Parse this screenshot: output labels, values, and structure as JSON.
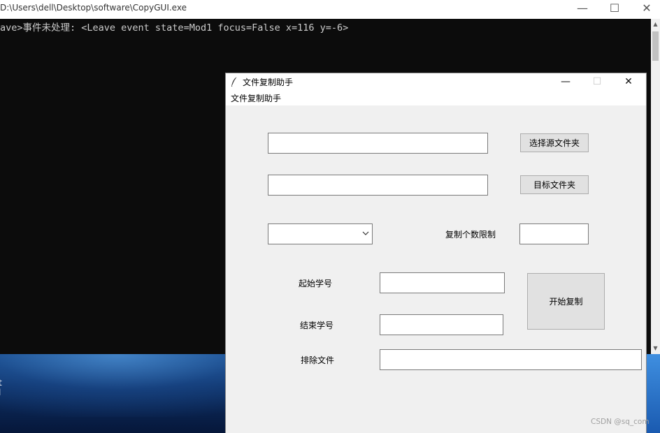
{
  "console": {
    "title": "D:\\Users\\dell\\Desktop\\software\\CopyGUI.exe",
    "output_line": "ave>事件未处理: <Leave event state=Mod1 focus=False x=116 y=-6>",
    "controls": {
      "minimize": "—",
      "maximize": "☐",
      "close": "✕"
    }
  },
  "desktop": {
    "fragment_text": "t\nl"
  },
  "app": {
    "title": "文件复制助手",
    "menu_label": "文件复制助手",
    "controls": {
      "minimize": "—",
      "maximize": "☐",
      "close": "✕"
    },
    "source_path": {
      "value": ""
    },
    "target_path": {
      "value": ""
    },
    "select_source_button": "选择源文件夹",
    "target_folder_button": "目标文件夹",
    "combo": {
      "value": ""
    },
    "copy_limit": {
      "label": "复制个数限制",
      "value": ""
    },
    "start_id": {
      "label": "起始学号",
      "value": ""
    },
    "end_id": {
      "label": "结束学号",
      "value": ""
    },
    "exclude_files": {
      "label": "排除文件",
      "value": ""
    },
    "start_copy_button": "开始复制"
  },
  "watermark": "CSDN @sq_com"
}
